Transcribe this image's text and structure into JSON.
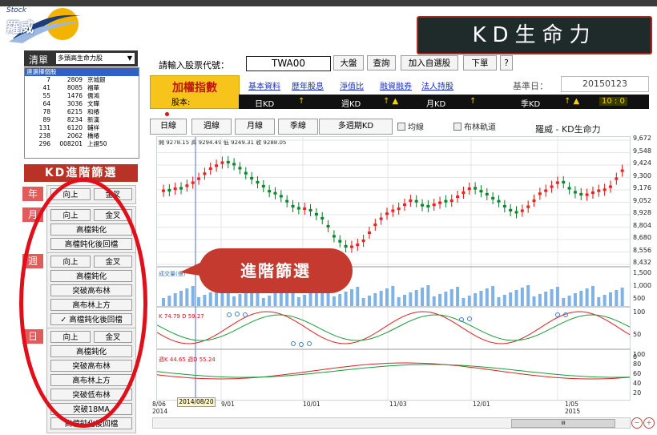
{
  "app": {
    "logo_small": "Stock",
    "logo_main": "羅威",
    "banner": "KD生命力"
  },
  "left": {
    "list_title": "清單",
    "list_select": "多頭高生命力股",
    "list_header": "連選擇個股",
    "rows": [
      {
        "rank": "7",
        "code": "2809",
        "name": "京城銀"
      },
      {
        "rank": "41",
        "code": "8085",
        "name": "福華"
      },
      {
        "rank": "55",
        "code": "1476",
        "name": "儒鴻"
      },
      {
        "rank": "64",
        "code": "3036",
        "name": "文曄"
      },
      {
        "rank": "78",
        "code": "6215",
        "name": "和椿"
      },
      {
        "rank": "89",
        "code": "8234",
        "name": "新漢"
      },
      {
        "rank": "131",
        "code": "6120",
        "name": "輔祥"
      },
      {
        "rank": "238",
        "code": "2062",
        "name": "橋椿"
      },
      {
        "rank": "296",
        "code": "008201",
        "name": "上證50"
      }
    ],
    "filter_title": "KD進階篩選",
    "groups": {
      "year": {
        "tag": "年",
        "buttons": [
          "向上",
          "金叉"
        ]
      },
      "month": {
        "tag": "月",
        "buttons": [
          "向上",
          "金叉",
          "高檔鈍化",
          "高檔鈍化後回檔"
        ]
      },
      "week": {
        "tag": "週",
        "buttons": [
          "向上",
          "金叉",
          "高檔鈍化",
          "突破高布林",
          "高布林上方",
          "✓ 高檔鈍化後回檔"
        ]
      },
      "day": {
        "tag": "日",
        "buttons": [
          "向上",
          "金叉",
          "高檔鈍化",
          "突破高布林",
          "高布林上方",
          "突破低布林",
          "突破18MA",
          "高檔鈍化後回檔"
        ]
      }
    }
  },
  "main": {
    "input_label": "請輸入股票代號：",
    "input_value": "TWA00",
    "buttons": [
      "大盤",
      "查詢",
      "加入自選股",
      "下單",
      "?"
    ],
    "index_name": "加權指數",
    "share_label": "股本:",
    "links": [
      "基本資料",
      "歷年股息",
      "淨值比",
      "融資融券",
      "法人持股"
    ],
    "base_date_label": "基準日：",
    "base_date": "20150123",
    "kd_labels": [
      "日KD",
      "↑",
      "週KD",
      "↑ ▲",
      "月KD",
      "↑",
      "季KD",
      "↑ ▲",
      "10 : 0"
    ],
    "period_tabs": [
      "日線",
      "週線",
      "月線",
      "季線",
      "多週期KD"
    ],
    "checks": [
      "均線",
      "布林軌道"
    ],
    "chart_title": "羅威 - KD生命力",
    "ohlc_line": "開 9278.15  高 9294.49  低 9249.31  收 9288.05",
    "vol_label": "成交量(億)",
    "k1_label": "K 74.79   D 59.27",
    "k2_label": "週K 44.65   週D 55.24",
    "date_tip": "2014/08/20",
    "x_labels": [
      "8/06\n2014",
      "9/01",
      "10/01",
      "11/03",
      "12/01",
      "1/05\n2015"
    ],
    "price_ticks": [
      "9,672",
      "9,548",
      "9,424",
      "9,300",
      "9,176",
      "9,052",
      "8,928",
      "8,804",
      "8,680",
      "8,556",
      "8,432"
    ],
    "vol_ticks": [
      "1,500",
      "1,000",
      "500"
    ],
    "k1_ticks": [
      "100",
      "50",
      "0"
    ],
    "k2_ticks": [
      "100",
      "80",
      "60",
      "40",
      "20"
    ],
    "bubble": "進階篩選",
    "scroll_mid": "III"
  },
  "chart_data": {
    "type": "line",
    "title": "羅威 - KD生命力",
    "x": [
      "8/06",
      "9/01",
      "10/01",
      "11/03",
      "12/01",
      "1/05"
    ],
    "series": [
      {
        "values": [
          9280,
          9460,
          9200,
          8650,
          9080,
          9190
        ]
      }
    ],
    "ylim": [
      8432,
      9672
    ]
  }
}
